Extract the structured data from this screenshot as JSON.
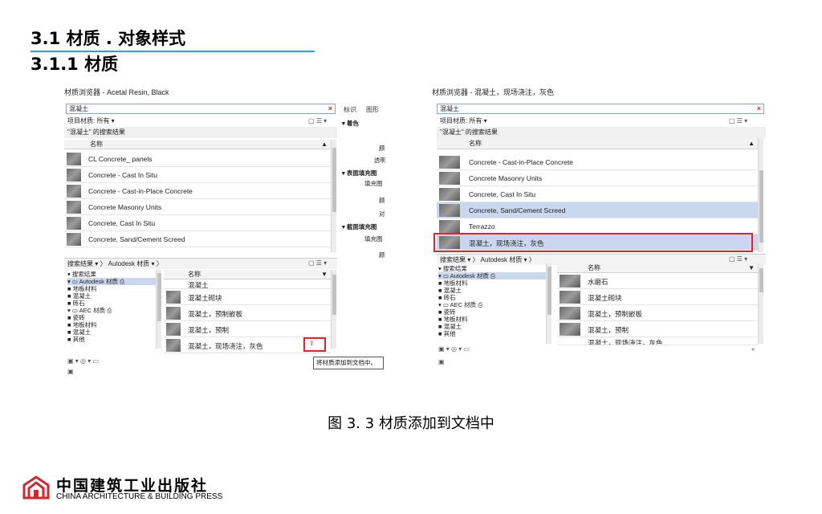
{
  "heading1": "3.1  材质 . 对象样式",
  "heading2": "3.1.1 材质",
  "caption": "图 3. 3 材质添加到文档中",
  "colors": {
    "accent_line": "#2aa3d8",
    "highlight_red": "#e0262a",
    "selection": "#c9d8ef"
  },
  "left_panel": {
    "title": "材质浏览器 - Acetal Resin, Black",
    "search_value": "混凝土",
    "close_icon": "×",
    "filter_label": "项目材质: 所有 ▾",
    "view_icons": "▢ ☰ ▾",
    "results_label": "\"混凝土\" 的搜索结果",
    "column_name": "名称",
    "items": [
      "CL Concrete_ panels",
      "Concrete - Cast In Situ",
      "Concrete - Cast-in-Place Concrete",
      "Concrete Masonry Units",
      "Concrete, Cast In Situ",
      "Concrete, Sand/Cement Screed"
    ],
    "breadcrumb": "搜索结果 ▾ 〉 Autodesk 材质 ▾ 〉",
    "tree": [
      "▾ 搜索结果",
      "▾ ▭ Autodesk 材质 ⎙",
      "   ■ 地板材料",
      "   ■ 混凝土",
      "   ■ 砖石",
      "▾ ▭ AEC 材质       ⎙",
      "   ■ 瓷砖",
      "   ■ 地板材料",
      "   ■ 混凝土",
      "   ■ 其他"
    ],
    "lib_column_name": "名称",
    "lib_items": [
      "混凝土",
      "混凝土砌块",
      "混凝土，预制嵌板",
      "混凝土，预制",
      "混凝土，现场浇注，灰色"
    ],
    "tabs": [
      "标识",
      "图形"
    ],
    "props": [
      "▾ 着色",
      "颜",
      "透明",
      "▾ 表面填充图",
      "填充图",
      "颜",
      "对",
      "▾ 截面填充图",
      "填充图",
      "颜"
    ],
    "tooltip": "将材质添加到文档中。",
    "bottom_icons": "▣ ▾ ◎ ▾ ▭"
  },
  "right_panel": {
    "title": "材质浏览器 - 混凝土，现场浇注，灰色",
    "search_value": "混凝土",
    "close_icon": "×",
    "filter_label": "项目材质: 所有 ▾",
    "view_icons": "▢ ☰ ▾",
    "results_label": "\"混凝土\" 的搜索结果",
    "column_name": "名称",
    "items": [
      "Concrete - Cast-in-Place Concrete",
      "Concrete Masonry Units",
      "Concrete, Cast In Situ",
      "Concrete, Sand/Cement Screed",
      "Terrazzo",
      "混凝土，现场浇注，灰色"
    ],
    "breadcrumb": "搜索结果 ▾ 〉 Autodesk 材质 ▾ 〉",
    "tree": [
      "▾ 搜索结果",
      "▾ ▭ Autodesk 材质 ⎙",
      "   ■ 地板材料",
      "   ■ 混凝土",
      "   ■ 砖石",
      "▾ ▭ AEC 材质       ⎙",
      "   ■ 瓷砖",
      "   ■ 地板材料",
      "   ■ 混凝土",
      "   ■ 其他"
    ],
    "lib_column_name": "名称",
    "lib_items": [
      "水磨石",
      "混凝土砌块",
      "混凝土，预制嵌板",
      "混凝土，预制",
      "混凝土，现场浇注，灰色"
    ],
    "bottom_icons": "▣ ▾ ◎ ▾ ▭",
    "collapse_icon": "«"
  },
  "logo": {
    "cn": "中国建筑工业出版社",
    "en": "CHINA ARCHITECTURE & BUILDING PRESS"
  }
}
